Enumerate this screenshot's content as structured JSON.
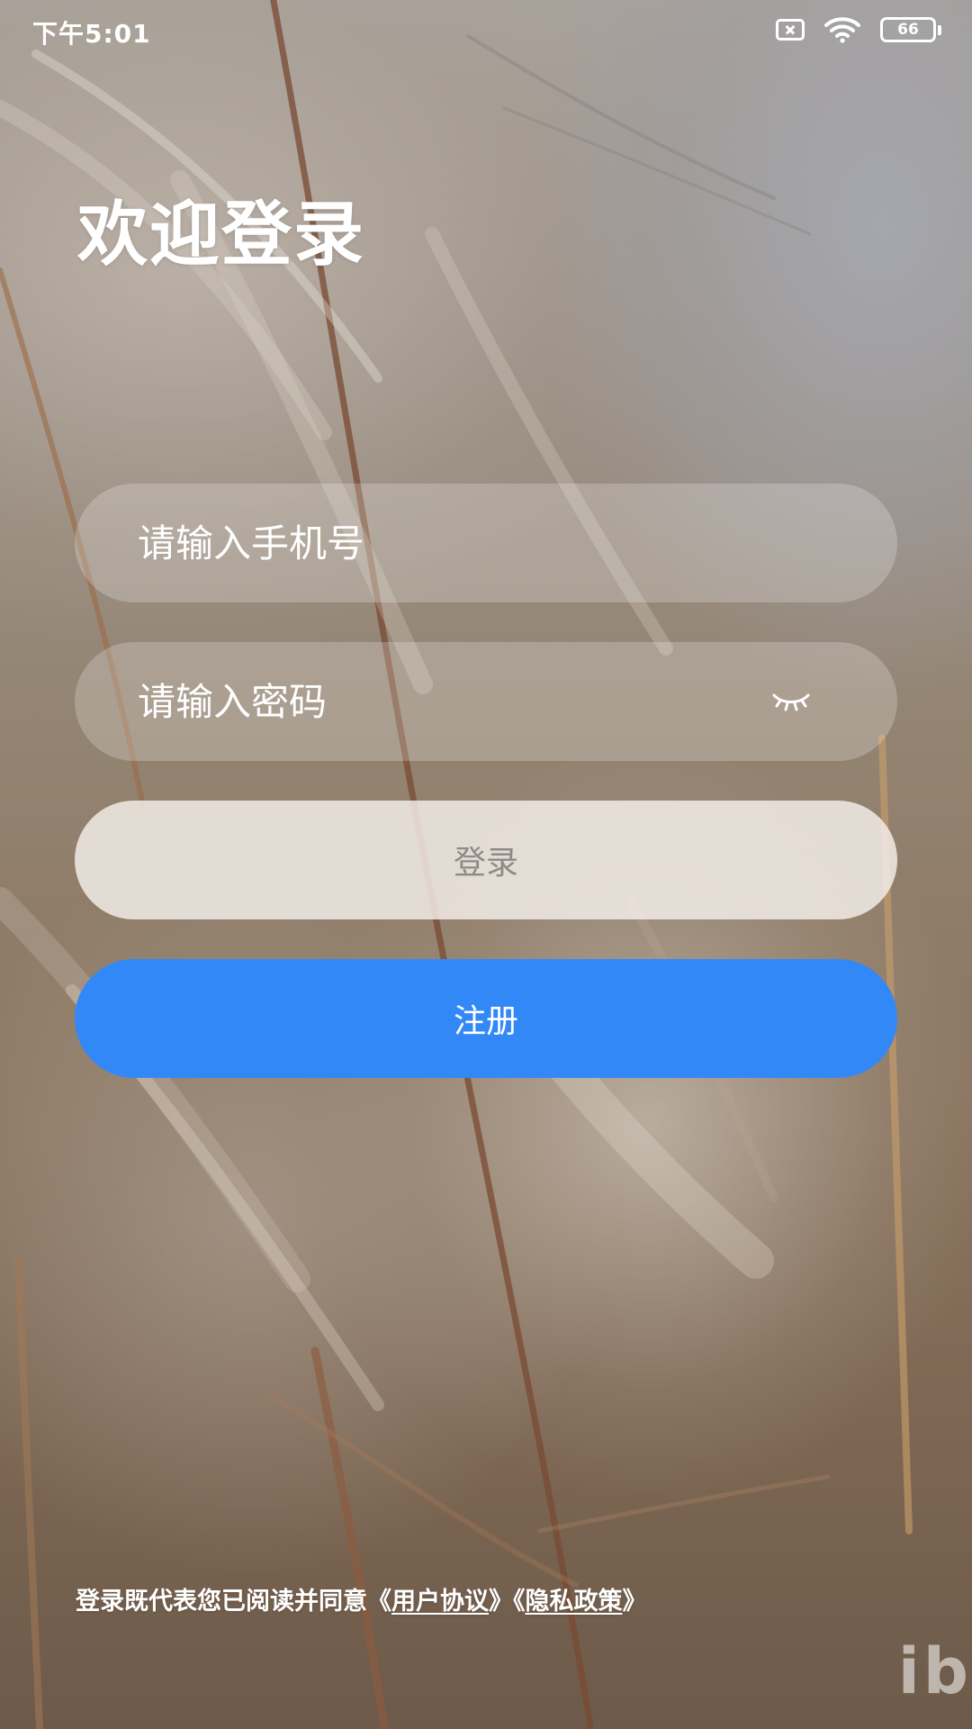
{
  "status_bar": {
    "time": "下午5:01",
    "battery": "66"
  },
  "title": "欢迎登录",
  "form": {
    "phone_placeholder": "请输入手机号",
    "phone_value": "",
    "password_placeholder": "请输入密码",
    "password_value": "",
    "login_label": "登录",
    "register_label": "注册"
  },
  "agreement": {
    "prefix": "登录既代表您已阅读并同意《",
    "user_agreement": "用户协议",
    "middle": "》《",
    "privacy_policy": "隐私政策",
    "suffix": "》"
  },
  "watermark": "ib",
  "colors": {
    "register_button": "#3388f7",
    "login_button_text": "#8f8a86",
    "text": "#ffffff"
  },
  "icons": {
    "sim": "sim-absent-icon",
    "wifi": "wifi-icon",
    "battery": "battery-icon",
    "password_toggle": "eye-closed-icon"
  }
}
